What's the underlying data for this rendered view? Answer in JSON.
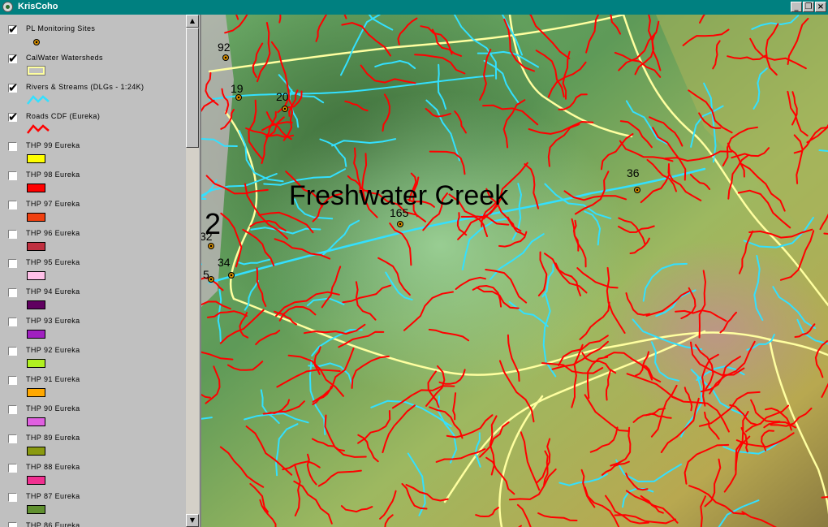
{
  "window": {
    "title": "KrisCoho",
    "buttons": {
      "minimize": "_",
      "restore": "❐",
      "close": "×"
    }
  },
  "legend": {
    "layers": [
      {
        "label": "PL Monitoring Sites",
        "checked": true,
        "symbol": "point",
        "color": "#d08a00"
      },
      {
        "label": "CalWater Watersheds",
        "checked": true,
        "symbol": "polygon",
        "color": "#ffffa0"
      },
      {
        "label": "Rivers & Streams (DLGs - 1:24K)",
        "checked": true,
        "symbol": "line",
        "color": "#33e0ff"
      },
      {
        "label": "Roads CDF (Eureka)",
        "checked": true,
        "symbol": "line",
        "color": "#ff0000"
      },
      {
        "label": "THP 99 Eureka",
        "checked": false,
        "symbol": "fill",
        "color": "#ffff00"
      },
      {
        "label": "THP 98 Eureka",
        "checked": false,
        "symbol": "fill",
        "color": "#ff0000"
      },
      {
        "label": "THP 97 Eureka",
        "checked": false,
        "symbol": "fill",
        "color": "#f04010"
      },
      {
        "label": "THP 96 Eureka",
        "checked": false,
        "symbol": "fill",
        "color": "#c03040"
      },
      {
        "label": "THP 95 Eureka",
        "checked": false,
        "symbol": "fill",
        "color": "#ffc0e8"
      },
      {
        "label": "THP 94 Eureka",
        "checked": false,
        "symbol": "fill",
        "color": "#600060"
      },
      {
        "label": "THP 93 Eureka",
        "checked": false,
        "symbol": "fill",
        "color": "#a020c0"
      },
      {
        "label": "THP 92 Eureka",
        "checked": false,
        "symbol": "fill",
        "color": "#b0f020"
      },
      {
        "label": "THP 91 Eureka",
        "checked": false,
        "symbol": "fill",
        "color": "#ffa800"
      },
      {
        "label": "THP 90 Eureka",
        "checked": false,
        "symbol": "fill",
        "color": "#e060e0"
      },
      {
        "label": "THP 89 Eureka",
        "checked": false,
        "symbol": "fill",
        "color": "#8a9a10"
      },
      {
        "label": "THP 88 Eureka",
        "checked": false,
        "symbol": "fill",
        "color": "#f03090"
      },
      {
        "label": "THP 87 Eureka",
        "checked": false,
        "symbol": "fill",
        "color": "#609030"
      },
      {
        "label": "THP 86 Eureka",
        "checked": false,
        "symbol": "fill",
        "color": "#ffffff"
      }
    ],
    "scroll": {
      "up": "▲",
      "down": "▼"
    }
  },
  "map": {
    "watershed_label": "Freshwater Creek",
    "zone_label": "2",
    "sites": [
      "92",
      "19",
      "20",
      "36",
      "165",
      "32",
      "34",
      "5"
    ],
    "colors": {
      "roads": "#ff0000",
      "streams": "#33e0ff",
      "watershed_boundary": "#ffffa0",
      "site": "#d08a00"
    }
  }
}
